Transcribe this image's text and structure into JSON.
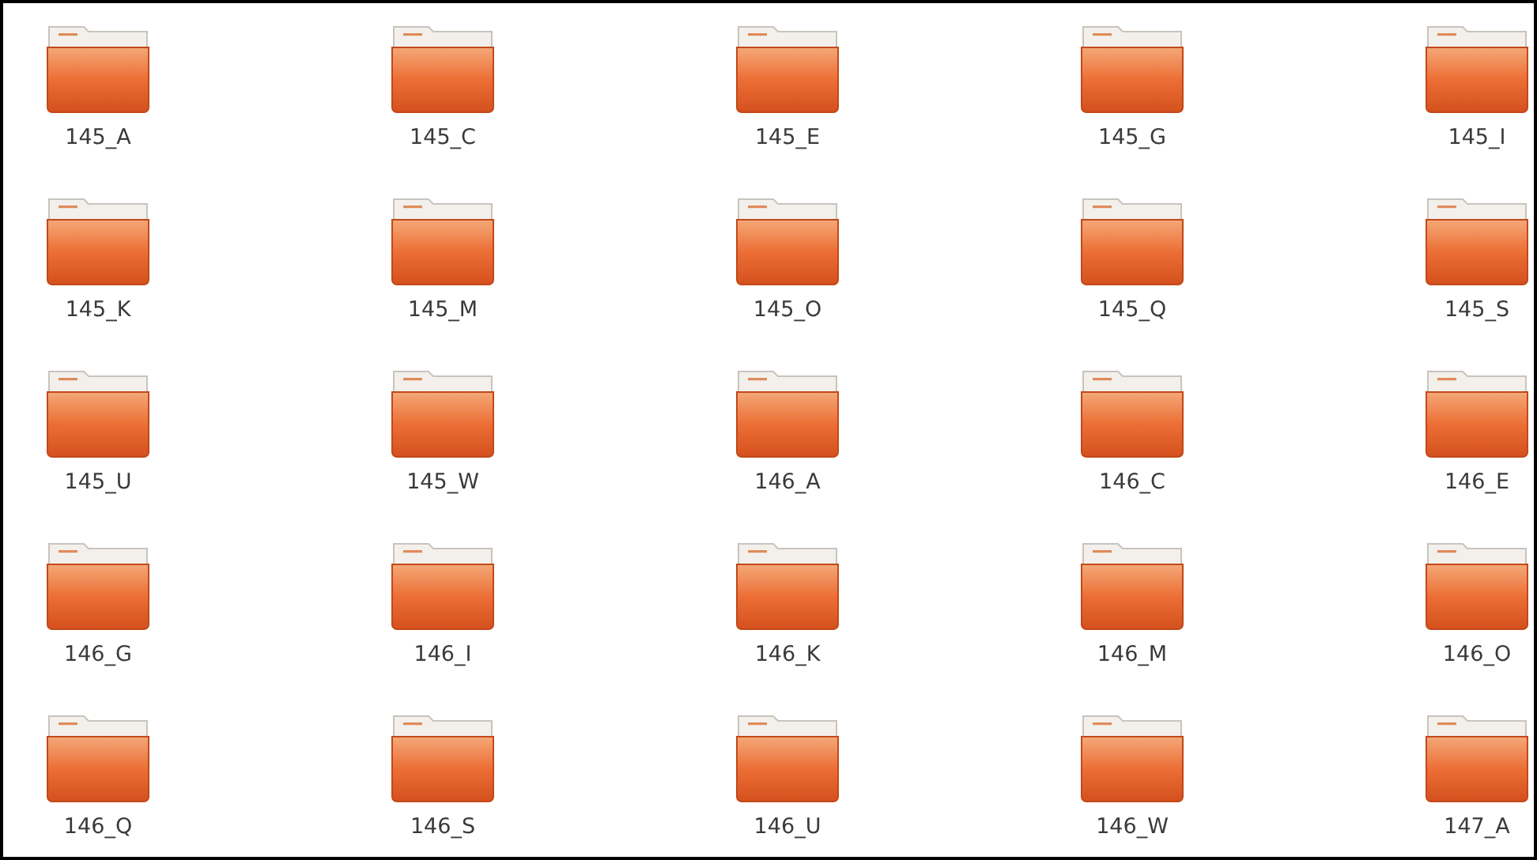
{
  "folders": [
    {
      "name": "145_A"
    },
    {
      "name": "145_C"
    },
    {
      "name": "145_E"
    },
    {
      "name": "145_G"
    },
    {
      "name": "145_I"
    },
    {
      "name": "145_K"
    },
    {
      "name": "145_M"
    },
    {
      "name": "145_O"
    },
    {
      "name": "145_Q"
    },
    {
      "name": "145_S"
    },
    {
      "name": "145_U"
    },
    {
      "name": "145_W"
    },
    {
      "name": "146_A"
    },
    {
      "name": "146_C"
    },
    {
      "name": "146_E"
    },
    {
      "name": "146_G"
    },
    {
      "name": "146_I"
    },
    {
      "name": "146_K"
    },
    {
      "name": "146_M"
    },
    {
      "name": "146_O"
    },
    {
      "name": "146_Q"
    },
    {
      "name": "146_S"
    },
    {
      "name": "146_U"
    },
    {
      "name": "146_W"
    },
    {
      "name": "147_A"
    }
  ]
}
